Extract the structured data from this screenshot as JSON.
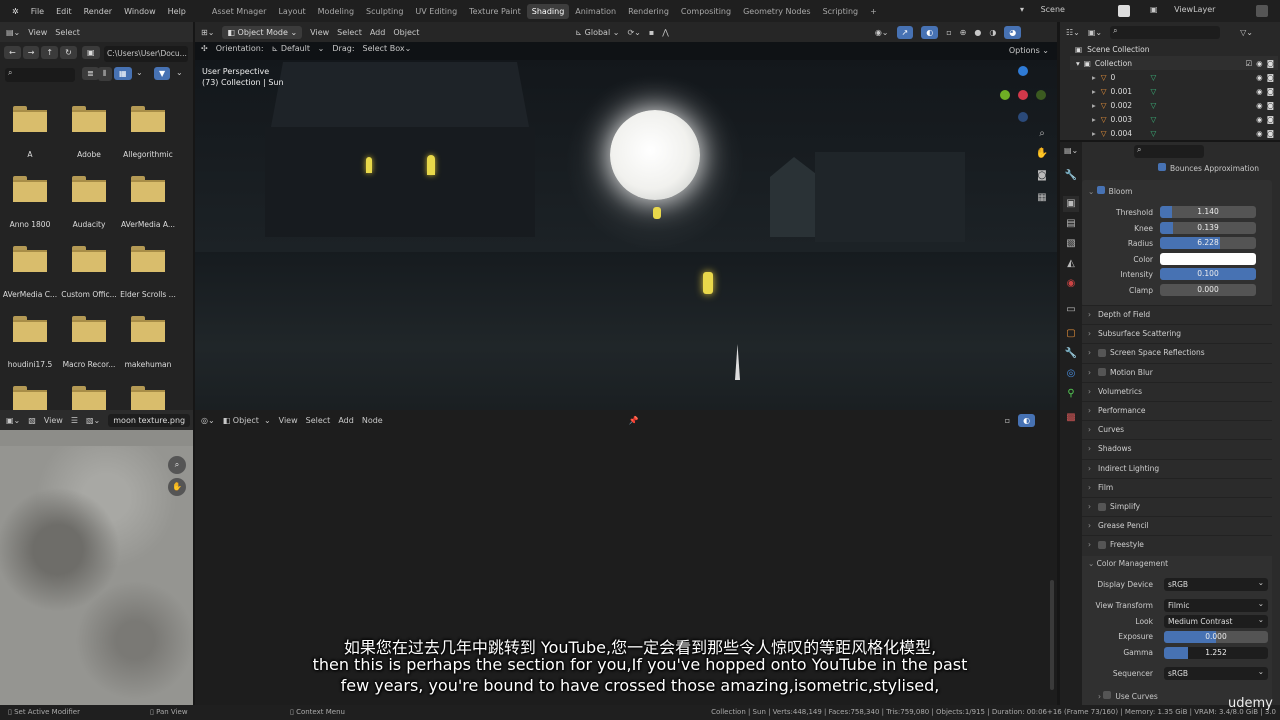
{
  "menu": {
    "items": [
      "File",
      "Edit",
      "Render",
      "Window",
      "Help"
    ],
    "workspaces": [
      "Asset Mnager",
      "Layout",
      "Modeling",
      "Sculpting",
      "UV Editing",
      "Texture Paint",
      "Shading",
      "Animation",
      "Rendering",
      "Compositing",
      "Geometry Nodes",
      "Scripting"
    ],
    "active_workspace": "Shading",
    "add": "+",
    "scene": "Scene",
    "view_layer": "ViewLayer"
  },
  "file_browser": {
    "header": [
      "View",
      "Select"
    ],
    "path": "C:\\Users\\User\\Docu...",
    "folders": [
      "A",
      "Adobe",
      "Allegorithmic",
      "Anno 1800",
      "Audacity",
      "AVerMedia A...",
      "AVerMedia C...",
      "Custom Offic...",
      "Elder Scrolls ...",
      "houdini17.5",
      "Macro Recor...",
      "makehuman",
      "",
      "",
      ""
    ]
  },
  "image_editor": {
    "view": "View",
    "image": "moon texture.png"
  },
  "viewport": {
    "mode": "Object Mode",
    "menus": [
      "View",
      "Select",
      "Add",
      "Object"
    ],
    "orientation_label": "Orientation:",
    "orientation": "Default",
    "drag_label": "Drag:",
    "drag": "Select Box",
    "transform": "Global",
    "options": "Options",
    "overlay_title": "User Perspective",
    "overlay_sub": "(73) Collection | Sun"
  },
  "shader_editor": {
    "mode": "Object",
    "menus": [
      "View",
      "Select",
      "Add",
      "Node"
    ]
  },
  "outliner": {
    "root": "Scene Collection",
    "collection": "Collection",
    "items": [
      "0",
      "0.001",
      "0.002",
      "0.003",
      "0.004"
    ]
  },
  "properties": {
    "bounces": "Bounces Approximation",
    "bloom": {
      "label": "Bloom",
      "fields": [
        {
          "label": "Threshold",
          "value": "1.140",
          "fill": 0.12
        },
        {
          "label": "Knee",
          "value": "0.139",
          "fill": 0.14
        },
        {
          "label": "Radius",
          "value": "6.228",
          "fill": 0.62
        },
        {
          "label": "Color",
          "value": "",
          "fill": 0
        },
        {
          "label": "Intensity",
          "value": "0.100",
          "fill": 1.0
        },
        {
          "label": "Clamp",
          "value": "0.000",
          "fill": 0
        }
      ]
    },
    "sections": [
      {
        "label": "Depth of Field",
        "cb": false
      },
      {
        "label": "Subsurface Scattering",
        "cb": false
      },
      {
        "label": "Screen Space Reflections",
        "cb": true
      },
      {
        "label": "Motion Blur",
        "cb": true
      },
      {
        "label": "Volumetrics",
        "cb": false
      },
      {
        "label": "Performance",
        "cb": false
      },
      {
        "label": "Curves",
        "cb": false
      },
      {
        "label": "Shadows",
        "cb": false
      },
      {
        "label": "Indirect Lighting",
        "cb": false
      },
      {
        "label": "Film",
        "cb": false
      },
      {
        "label": "Simplify",
        "cb": true
      },
      {
        "label": "Grease Pencil",
        "cb": false
      },
      {
        "label": "Freestyle",
        "cb": true
      }
    ],
    "color_management": {
      "label": "Color Management",
      "display_device_label": "Display Device",
      "display_device": "sRGB",
      "view_transform_label": "View Transform",
      "view_transform": "Filmic",
      "look_label": "Look",
      "look": "Medium Contrast",
      "exposure_label": "Exposure",
      "exposure": "0.000",
      "gamma_label": "Gamma",
      "gamma": "1.252",
      "sequencer_label": "Sequencer",
      "sequencer": "sRGB",
      "use_curves": "Use Curves"
    }
  },
  "status": {
    "left": "Set Active Modifier",
    "mid": "Pan View",
    "ctx": "Context Menu",
    "stats": "Collection | Sun | Verts:448,149 | Faces:758,340 | Tris:759,080 | Objects:1/915 | Duration: 00:06+16 (Frame 73/160) | Memory: 1.35 GiB | VRAM: 3.4/8.0 GiB | 3.0"
  },
  "subtitles": [
    "如果您在过去几年中跳转到 YouTube,您一定会看到那些令人惊叹的等距风格化模型,",
    "then this is perhaps the section for you,If you've hopped onto YouTube in the past",
    "few years, you're bound to have crossed those amazing,isometric,stylised,"
  ],
  "watermark": "udemy"
}
